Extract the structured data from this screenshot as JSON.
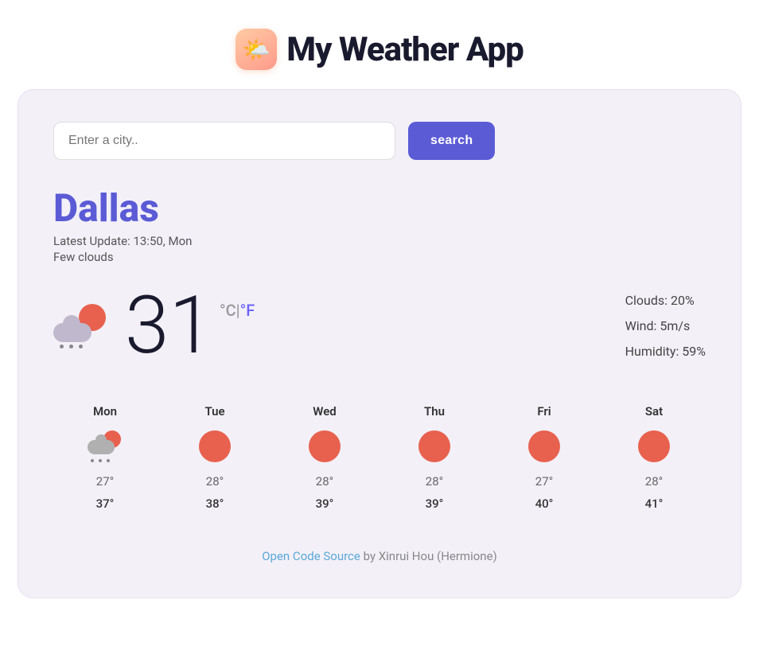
{
  "header": {
    "logo_emoji": "🌤️",
    "title": "My Weather App"
  },
  "search": {
    "placeholder": "Enter a city..",
    "button_label": "search"
  },
  "current": {
    "city": "Dallas",
    "update": "Latest Update: 13:50, Mon",
    "description": "Few clouds",
    "temperature": "31",
    "unit_celsius": "°C",
    "unit_separator": "|",
    "unit_fahrenheit": "°F",
    "clouds": "Clouds: 20%",
    "wind": "Wind: 5m/s",
    "humidity": "Humidity: 59%"
  },
  "forecast": [
    {
      "day": "Mon",
      "icon_type": "cloudy-rain",
      "low": "27°",
      "high": "37°"
    },
    {
      "day": "Tue",
      "icon_type": "sun",
      "low": "28°",
      "high": "38°"
    },
    {
      "day": "Wed",
      "icon_type": "sun",
      "low": "28°",
      "high": "39°"
    },
    {
      "day": "Thu",
      "icon_type": "sun",
      "low": "28°",
      "high": "39°"
    },
    {
      "day": "Fri",
      "icon_type": "sun",
      "low": "27°",
      "high": "40°"
    },
    {
      "day": "Sat",
      "icon_type": "sun",
      "low": "28°",
      "high": "41°"
    }
  ],
  "footer": {
    "link_text": "Open Code Source",
    "link_href": "#",
    "credit": " by Xinrui Hou (Hermione)"
  }
}
